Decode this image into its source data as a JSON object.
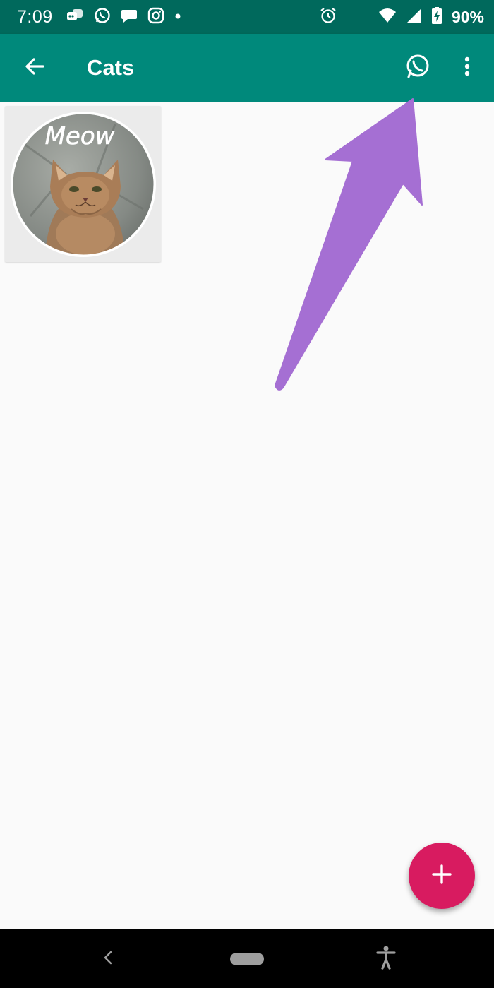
{
  "status_bar": {
    "time": "7:09",
    "battery": "90%",
    "left_icons": [
      "app-notification-icon",
      "whatsapp-icon",
      "message-bubble-icon",
      "instagram-icon",
      "dot-icon"
    ],
    "right_icons": [
      "alarm-icon",
      "wifi-icon",
      "signal-icon",
      "battery-charging-icon"
    ]
  },
  "app_bar": {
    "title": "Cats",
    "back_icon": "arrow-back-icon",
    "action_icon": "whatsapp-icon",
    "menu_icon": "more-vert-icon"
  },
  "sticker": {
    "text": "Meow"
  },
  "fab": {
    "icon": "plus-icon"
  },
  "nav_bar": {
    "icons": [
      "back-chevron-icon",
      "home-pill-icon",
      "accessibility-icon"
    ]
  },
  "colors": {
    "status_bar": "#00695c",
    "app_bar": "#00897b",
    "fab": "#d81b60",
    "annotation": "#a56fd3"
  }
}
